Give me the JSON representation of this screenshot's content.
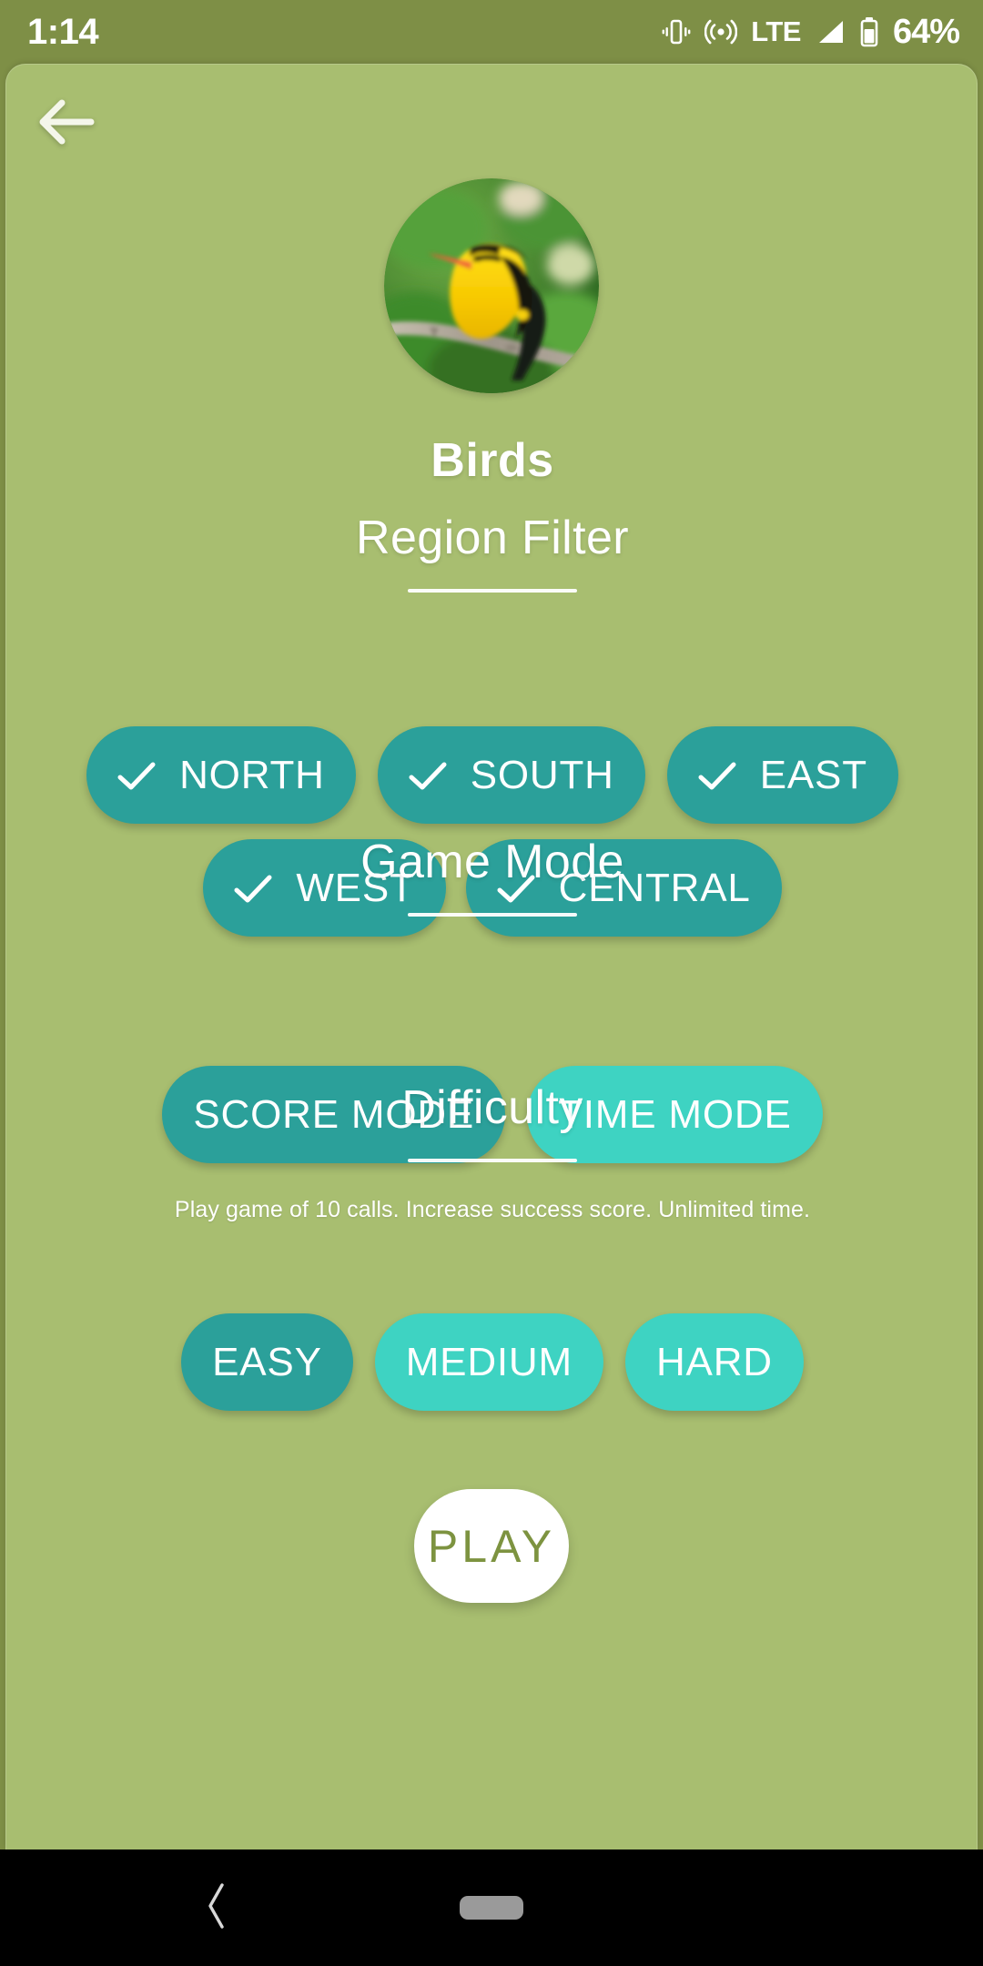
{
  "status_bar": {
    "time": "1:14",
    "battery_percent": "64%",
    "network_label": "LTE",
    "icons": [
      "vibrate-icon",
      "hotspot-icon",
      "signal-icon",
      "battery-icon"
    ]
  },
  "colors": {
    "status_bar_bg": "#7e8f46",
    "page_bg": "#a8be70",
    "chip_selected": "#2ba09a",
    "chip_unselected": "#3ed3c2",
    "play_button_bg": "#ffffff",
    "play_button_text": "#7d9340",
    "text_primary": "#ffffff"
  },
  "header": {
    "back_icon": "arrow-left-icon",
    "avatar_icon": "bird-photo",
    "title": "Birds"
  },
  "sections": {
    "region": {
      "heading": "Region Filter",
      "row_1": [
        {
          "label": "NORTH",
          "selected": true
        },
        {
          "label": "SOUTH",
          "selected": true
        },
        {
          "label": "EAST",
          "selected": true
        }
      ],
      "row_2": [
        {
          "label": "WEST",
          "selected": true
        },
        {
          "label": "CENTRAL",
          "selected": true
        }
      ]
    },
    "game_mode": {
      "heading": "Game Mode",
      "options": [
        {
          "label": "SCORE MODE",
          "selected": true
        },
        {
          "label": "TIME MODE",
          "selected": false
        }
      ],
      "description": "Play game of 10 calls. Increase success score. Unlimited time."
    },
    "difficulty": {
      "heading": "Difficulty",
      "options": [
        {
          "label": "EASY",
          "selected": true
        },
        {
          "label": "MEDIUM",
          "selected": false
        },
        {
          "label": "HARD",
          "selected": false
        }
      ]
    }
  },
  "play_button": {
    "label": "PLAY"
  },
  "nav_bar": {
    "back_icon": "chevron-left-icon",
    "home_icon": "home-pill-icon"
  }
}
